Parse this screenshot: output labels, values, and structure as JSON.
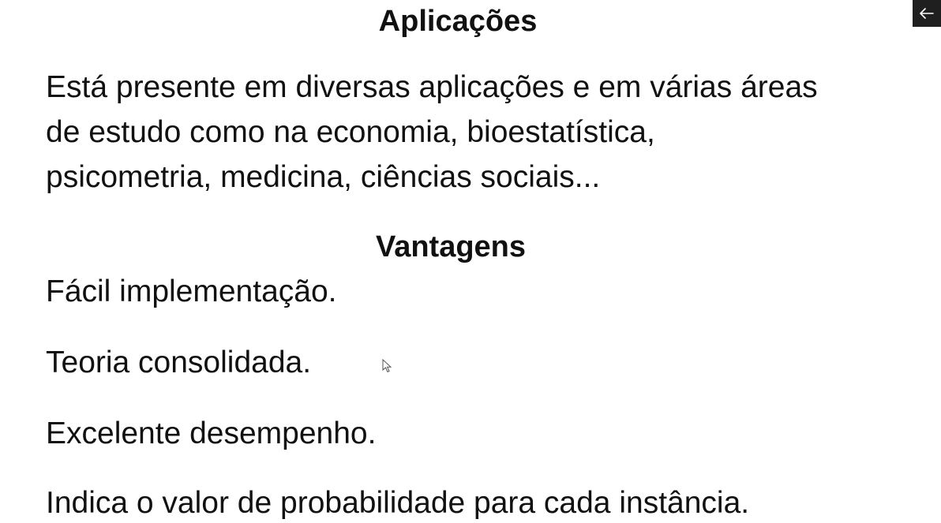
{
  "slide": {
    "applications": {
      "title": "Aplicações",
      "lines": [
        "Está presente em diversas aplicações e em várias áreas",
        "de estudo como na economia, bioestatística,",
        "psicometria, medicina, ciências sociais..."
      ]
    },
    "advantages": {
      "title": "Vantagens",
      "items": [
        "Fácil implementação.",
        "Teoria consolidada.",
        "Excelente desempenho.",
        "Indica o valor de probabilidade para cada instância."
      ]
    }
  },
  "controls": {
    "back_icon": "arrow-left-icon"
  },
  "colors": {
    "text": "#111111",
    "background": "#ffffff",
    "button_bg": "#1f1f1f"
  }
}
